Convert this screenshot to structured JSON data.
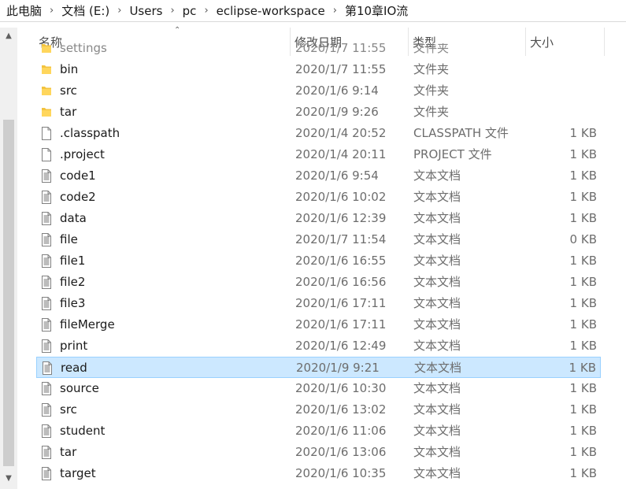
{
  "address_bar": {
    "crumbs": [
      "此电脑",
      "文档 (E:)",
      "Users",
      "pc",
      "eclipse-workspace",
      "第10章IO流"
    ]
  },
  "columns": {
    "name": "名称",
    "date": "修改日期",
    "type": "类型",
    "size": "大小"
  },
  "sort_indicator": "chevron-up-icon",
  "colors": {
    "folder": "#f3c33f",
    "selected_bg": "#cce8ff",
    "selected_border": "#99d1ff"
  },
  "files": [
    {
      "name": "settings",
      "date": "2020/1/7 11:55",
      "type": "文件夹",
      "size": "",
      "icon": "folder-icon",
      "partial": true
    },
    {
      "name": "bin",
      "date": "2020/1/7 11:55",
      "type": "文件夹",
      "size": "",
      "icon": "folder-icon"
    },
    {
      "name": "src",
      "date": "2020/1/6 9:14",
      "type": "文件夹",
      "size": "",
      "icon": "folder-icon"
    },
    {
      "name": "tar",
      "date": "2020/1/9 9:26",
      "type": "文件夹",
      "size": "",
      "icon": "folder-icon"
    },
    {
      "name": ".classpath",
      "date": "2020/1/4 20:52",
      "type": "CLASSPATH 文件",
      "size": "1 KB",
      "icon": "blank-file-icon"
    },
    {
      "name": ".project",
      "date": "2020/1/4 20:11",
      "type": "PROJECT 文件",
      "size": "1 KB",
      "icon": "blank-file-icon"
    },
    {
      "name": "code1",
      "date": "2020/1/6 9:54",
      "type": "文本文档",
      "size": "1 KB",
      "icon": "text-file-icon"
    },
    {
      "name": "code2",
      "date": "2020/1/6 10:02",
      "type": "文本文档",
      "size": "1 KB",
      "icon": "text-file-icon"
    },
    {
      "name": "data",
      "date": "2020/1/6 12:39",
      "type": "文本文档",
      "size": "1 KB",
      "icon": "text-file-icon"
    },
    {
      "name": "file",
      "date": "2020/1/7 11:54",
      "type": "文本文档",
      "size": "0 KB",
      "icon": "text-file-icon"
    },
    {
      "name": "file1",
      "date": "2020/1/6 16:55",
      "type": "文本文档",
      "size": "1 KB",
      "icon": "text-file-icon"
    },
    {
      "name": "file2",
      "date": "2020/1/6 16:56",
      "type": "文本文档",
      "size": "1 KB",
      "icon": "text-file-icon"
    },
    {
      "name": "file3",
      "date": "2020/1/6 17:11",
      "type": "文本文档",
      "size": "1 KB",
      "icon": "text-file-icon"
    },
    {
      "name": "fileMerge",
      "date": "2020/1/6 17:11",
      "type": "文本文档",
      "size": "1 KB",
      "icon": "text-file-icon"
    },
    {
      "name": "print",
      "date": "2020/1/6 12:49",
      "type": "文本文档",
      "size": "1 KB",
      "icon": "text-file-icon"
    },
    {
      "name": "read",
      "date": "2020/1/9 9:21",
      "type": "文本文档",
      "size": "1 KB",
      "icon": "text-file-icon",
      "selected": true
    },
    {
      "name": "source",
      "date": "2020/1/6 10:30",
      "type": "文本文档",
      "size": "1 KB",
      "icon": "text-file-icon"
    },
    {
      "name": "src",
      "date": "2020/1/6 13:02",
      "type": "文本文档",
      "size": "1 KB",
      "icon": "text-file-icon"
    },
    {
      "name": "student",
      "date": "2020/1/6 11:06",
      "type": "文本文档",
      "size": "1 KB",
      "icon": "text-file-icon"
    },
    {
      "name": "tar",
      "date": "2020/1/6 13:06",
      "type": "文本文档",
      "size": "1 KB",
      "icon": "text-file-icon"
    },
    {
      "name": "target",
      "date": "2020/1/6 10:35",
      "type": "文本文档",
      "size": "1 KB",
      "icon": "text-file-icon"
    }
  ]
}
